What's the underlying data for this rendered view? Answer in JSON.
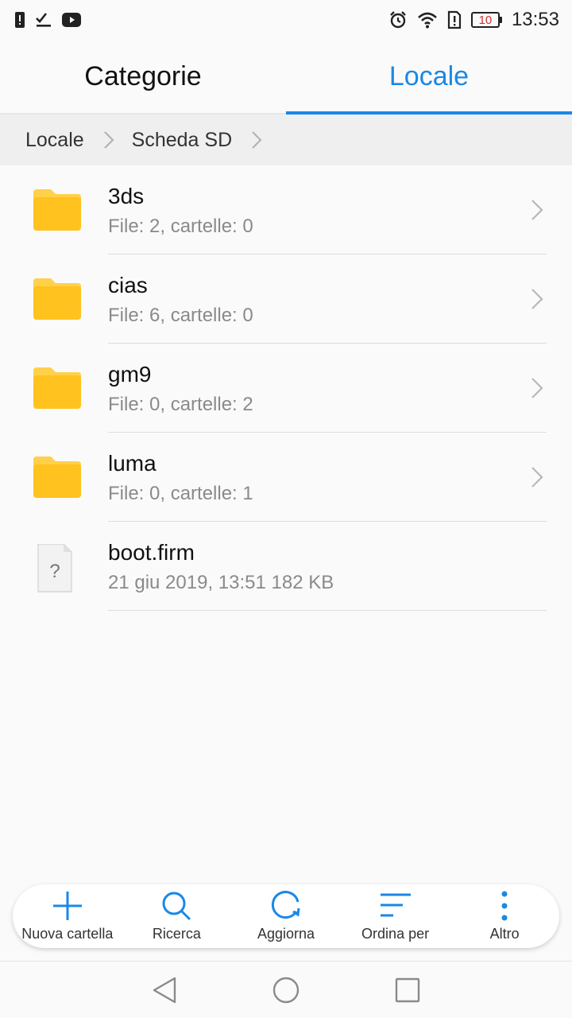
{
  "status_bar": {
    "time": "13:53",
    "battery_level": "10",
    "left_icons": [
      "alert-icon",
      "checklist-icon",
      "youtube-icon"
    ],
    "right_icons": [
      "alarm-icon",
      "wifi-icon",
      "sim-alert-icon",
      "battery-icon"
    ]
  },
  "tabs": [
    {
      "label": "Categorie",
      "active": false
    },
    {
      "label": "Locale",
      "active": true
    }
  ],
  "breadcrumb": [
    "Locale",
    "Scheda SD"
  ],
  "files": [
    {
      "name": "3ds",
      "meta": "File: 2, cartelle: 0",
      "type": "folder"
    },
    {
      "name": "cias",
      "meta": "File: 6, cartelle: 0",
      "type": "folder"
    },
    {
      "name": "gm9",
      "meta": "File: 0, cartelle: 2",
      "type": "folder"
    },
    {
      "name": "luma",
      "meta": "File: 0, cartelle: 1",
      "type": "folder"
    },
    {
      "name": "boot.firm",
      "meta": "21 giu 2019, 13:51 182 KB",
      "type": "unknown-file"
    }
  ],
  "toolbar": {
    "new_folder": "Nuova cartella",
    "search": "Ricerca",
    "refresh": "Aggiorna",
    "sort": "Ordina per",
    "more": "Altro"
  },
  "colors": {
    "accent": "#1a88e6",
    "folder": "#ffc21e",
    "folder_tab": "#ffd04a",
    "battery_low": "#d32f2f"
  },
  "nav": [
    "back-icon",
    "home-icon",
    "recents-icon"
  ]
}
